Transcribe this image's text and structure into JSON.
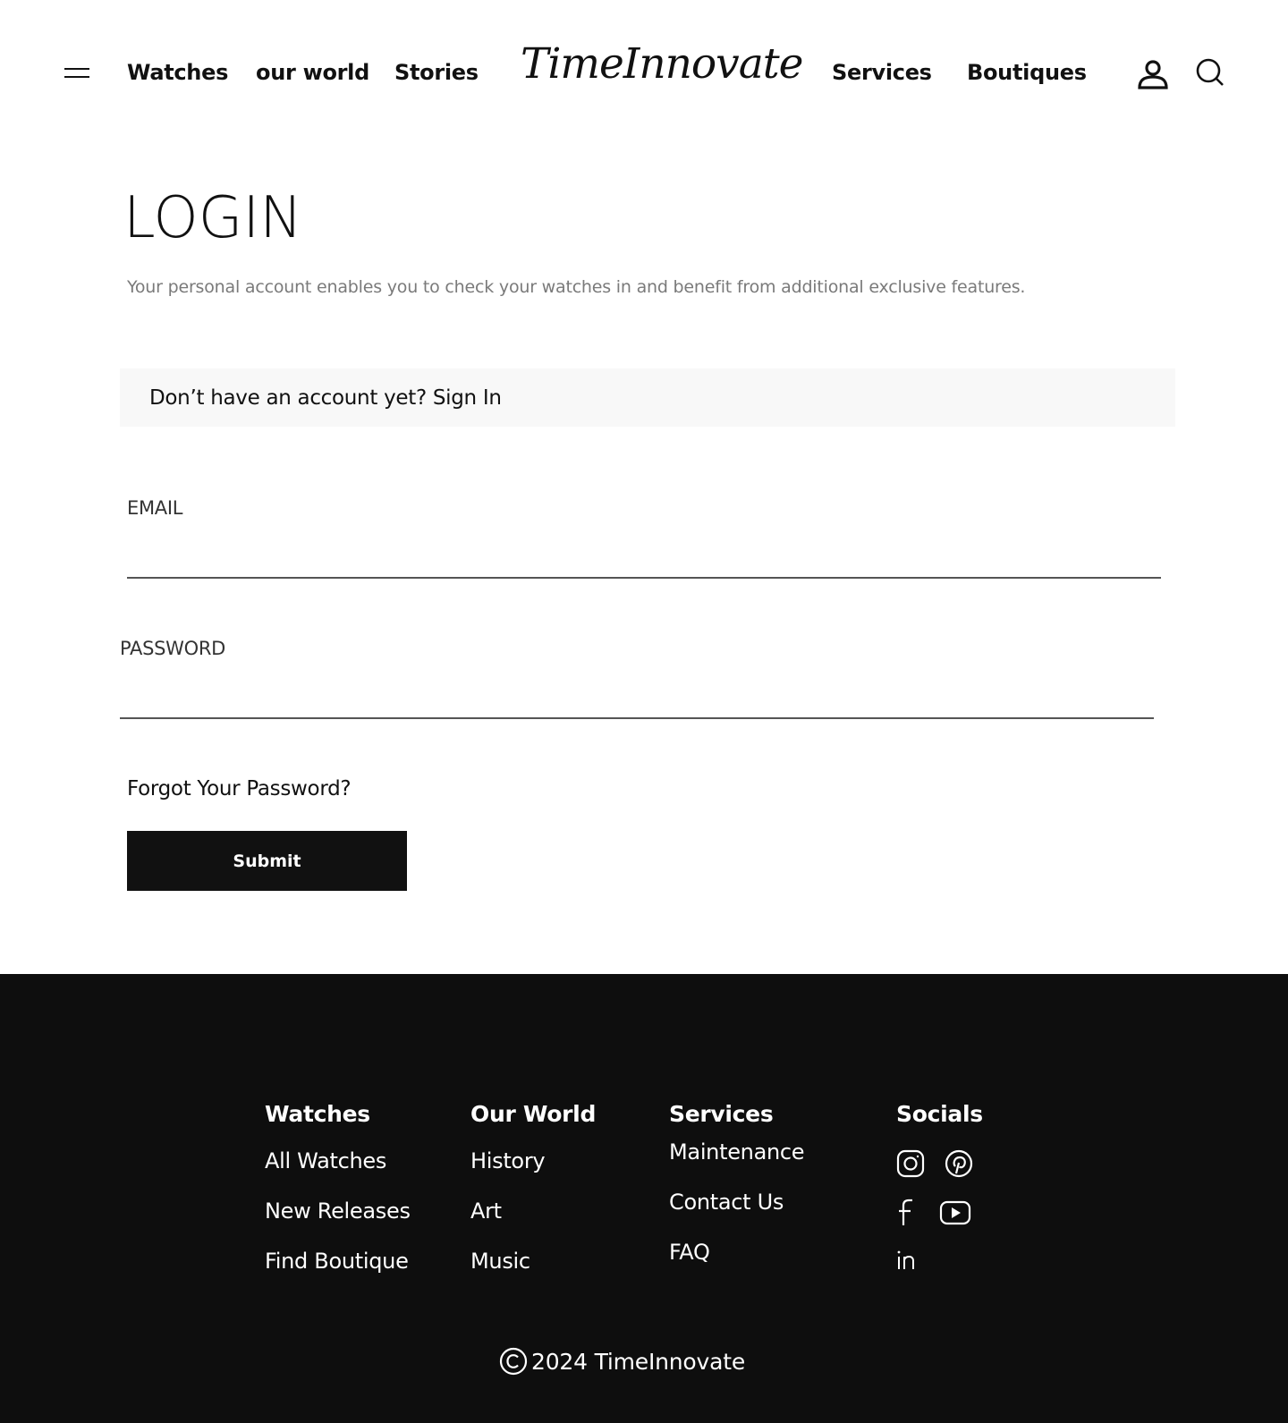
{
  "header": {
    "nav_left": [
      "Watches",
      "our world",
      "Stories"
    ],
    "logo": "TimeInnovate",
    "nav_right": [
      "Services",
      "Boutiques"
    ],
    "icons": [
      "menu-icon",
      "user-icon",
      "search-icon"
    ]
  },
  "login": {
    "title": "LOGIN",
    "intro": "Your personal account enables you to check your watches in and benefit from additional exclusive features.",
    "signup_prompt": "Don’t have an account yet? Sign In",
    "email_label": "EMAIL",
    "email_value": "",
    "password_label": "PASSWORD",
    "password_value": "",
    "forgot": "Forgot Your Password?",
    "submit": "Submit"
  },
  "footer": {
    "columns": [
      {
        "title": "Watches",
        "links": [
          "All Watches",
          "New Releases",
          "Find Boutique"
        ]
      },
      {
        "title": "Our World",
        "links": [
          "History",
          "Art",
          "Music"
        ]
      },
      {
        "title": "Services",
        "links": [
          "Maintenance",
          "Contact Us",
          "FAQ"
        ]
      },
      {
        "title": "Socials",
        "icons": [
          "instagram-icon",
          "pinterest-icon",
          "facebook-icon",
          "youtube-icon",
          "linkedin-icon"
        ]
      }
    ],
    "copyright": "2024 TimeInnovate"
  },
  "colors": {
    "text": "#111111",
    "muted": "#7a7a7a",
    "footer_bg": "#0e0e0e",
    "signup_bg": "#f8f8f8",
    "button_bg": "#111111"
  }
}
